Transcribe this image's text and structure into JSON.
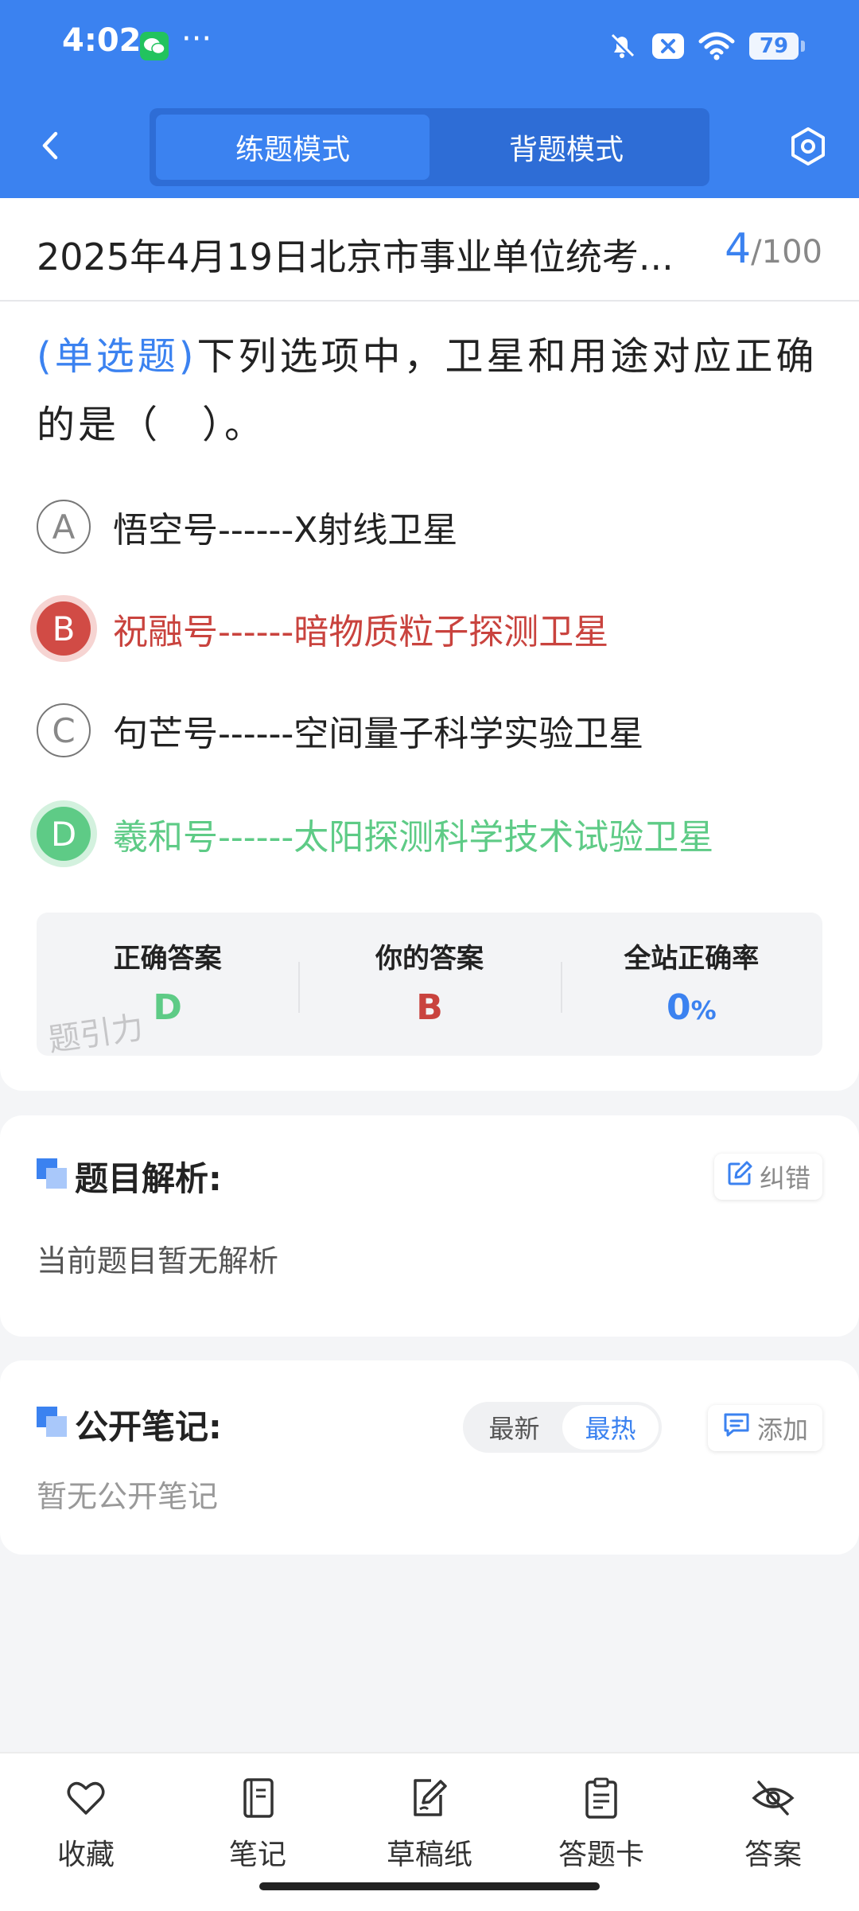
{
  "status_bar": {
    "time": "4:02",
    "more": "···",
    "battery": "79"
  },
  "header": {
    "modes": [
      "练题模式",
      "背题模式"
    ],
    "active_mode": "练题模式"
  },
  "exam": {
    "title": "2025年4月19日北京市事业单位统考...",
    "current": "4",
    "total": "/100"
  },
  "question": {
    "type": "(单选题)",
    "text": "下列选项中，卫星和用途对应正确的是（　）。",
    "options": [
      {
        "letter": "A",
        "text": "悟空号------X射线卫星",
        "state": "normal"
      },
      {
        "letter": "B",
        "text": "祝融号------暗物质粒子探测卫星",
        "state": "wrong"
      },
      {
        "letter": "C",
        "text": "句芒号------空间量子科学实验卫星",
        "state": "normal"
      },
      {
        "letter": "D",
        "text": "羲和号------太阳探测科学技术试验卫星",
        "state": "right"
      }
    ]
  },
  "stats": {
    "correct_label": "正确答案",
    "correct_value": "D",
    "yours_label": "你的答案",
    "yours_value": "B",
    "rate_label": "全站正确率",
    "rate_value": "0",
    "rate_unit": "%",
    "watermark": "题引力"
  },
  "analysis": {
    "title": "题目解析:",
    "report_label": "纠错",
    "body": "当前题目暂无解析"
  },
  "notes": {
    "title": "公开笔记:",
    "sort_options": [
      "最新",
      "最热"
    ],
    "active_sort": "最热",
    "add_label": "添加",
    "body": "暂无公开笔记"
  },
  "bottom_nav": [
    "收藏",
    "笔记",
    "草稿纸",
    "答题卡",
    "答案"
  ],
  "colors": {
    "primary": "#3b82f0",
    "correct": "#5ecb86",
    "wrong": "#d14b45"
  }
}
